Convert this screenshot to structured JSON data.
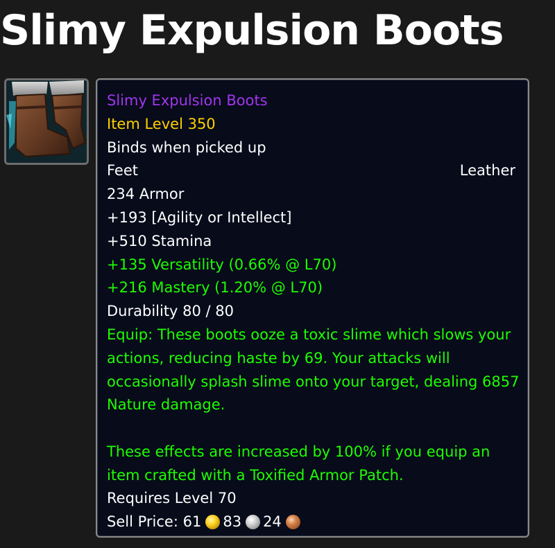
{
  "page": {
    "title": "Slimy Expulsion Boots"
  },
  "icon": {
    "name": "leather-boots-icon"
  },
  "tooltip": {
    "name": "Slimy Expulsion Boots",
    "item_level": "Item Level 350",
    "binding": "Binds when picked up",
    "slot": "Feet",
    "armor_type": "Leather",
    "armor": "234 Armor",
    "primary_stat": "+193 [Agility or Intellect]",
    "stamina": "+510 Stamina",
    "versatility": "+135 Versatility (0.66% @ L70)",
    "mastery": "+216 Mastery (1.20% @ L70)",
    "durability": "Durability 80 / 80",
    "equip_lines": [
      "Equip: These boots ooze a toxic slime which slows your",
      "actions, reducing haste by 69. Your attacks will",
      "occasionally splash slime onto your target, dealing 6857",
      "Nature damage."
    ],
    "bonus_lines": [
      "These effects are increased by 100% if you equip an",
      "item crafted with a Toxified Armor Patch."
    ],
    "requires": "Requires Level 70",
    "sell_price": {
      "label": "Sell Price:",
      "gold": "61",
      "silver": "83",
      "copper": "24"
    }
  },
  "colors": {
    "epic": "#a335ee",
    "item_level": "#ffd100",
    "green_text": "#1eff00",
    "tooltip_bg": "#070b1a"
  }
}
